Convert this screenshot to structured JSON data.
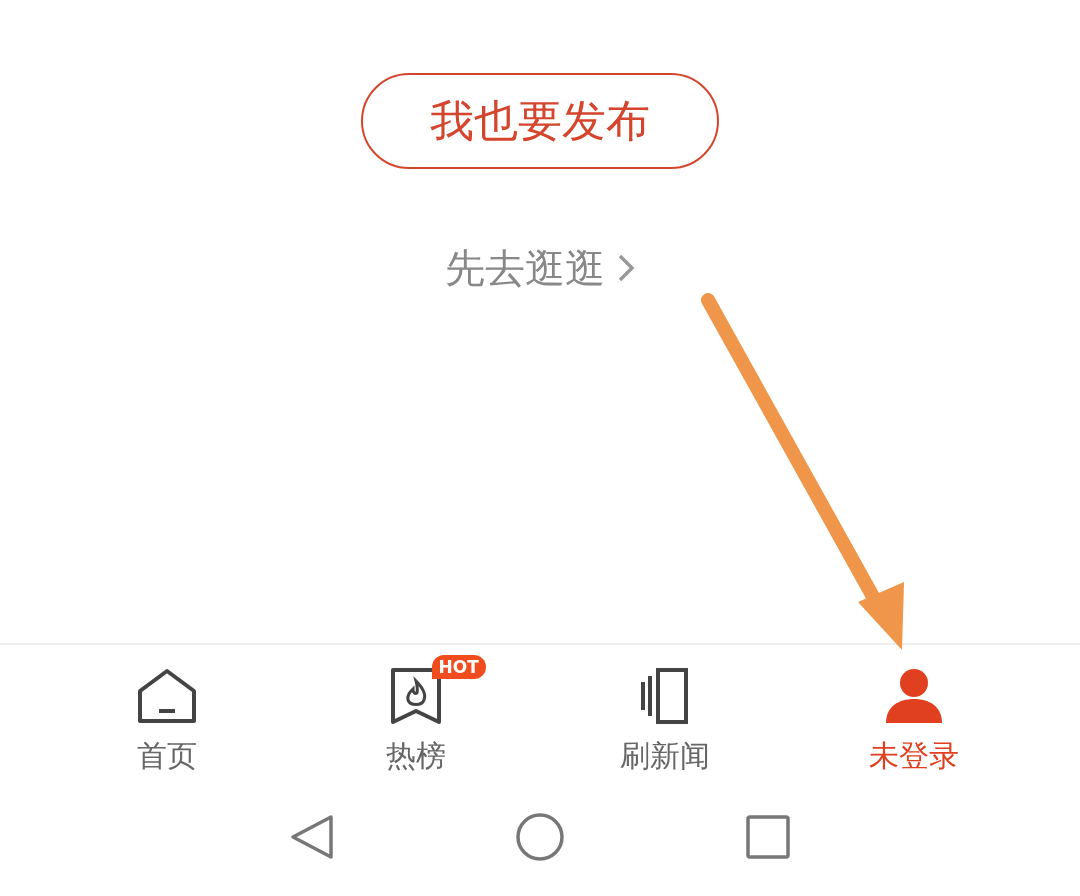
{
  "publish_button": {
    "label": "我也要发布"
  },
  "browse_link": {
    "label": "先去逛逛"
  },
  "tabs": [
    {
      "kind": "home",
      "label": "首页",
      "selected": false
    },
    {
      "kind": "hot",
      "label": "热榜",
      "selected": false,
      "badge": "HOT"
    },
    {
      "kind": "news",
      "label": "刷新闻",
      "selected": false
    },
    {
      "kind": "user",
      "label": "未登录",
      "selected": true
    }
  ]
}
